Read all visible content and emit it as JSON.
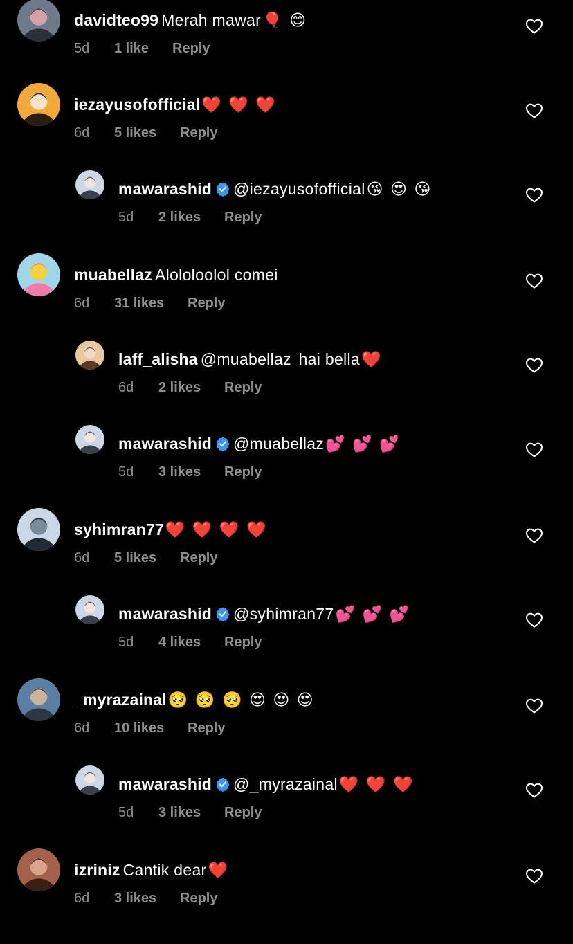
{
  "colors": {
    "background": "#000000",
    "text": "#ffffff",
    "meta": "#8e8e8e",
    "verified": "#3897f0",
    "heart_outline": "#ffffff"
  },
  "comments": [
    {
      "username": "davidteo99",
      "verified": false,
      "mention": "",
      "text": "Merah mawar",
      "emoji": "🎈 😊",
      "time": "5d",
      "likes": "1 like",
      "reply_label": "Reply",
      "like_icon": "heart-outline-icon",
      "avatar": "photo"
    },
    {
      "username": "iezayusofofficial",
      "verified": false,
      "mention": "",
      "text": "",
      "emoji": "❤️ ❤️ ❤️",
      "time": "6d",
      "likes": "5 likes",
      "reply_label": "Reply",
      "like_icon": "heart-outline-icon",
      "avatar": "photo"
    },
    {
      "username": "mawarashid",
      "verified": true,
      "mention": "@iezayusofofficial",
      "text": "",
      "emoji": "😘 😍 😘",
      "time": "5d",
      "likes": "2 likes",
      "reply_label": "Reply",
      "like_icon": "heart-outline-icon",
      "avatar": "photo"
    },
    {
      "username": "muabellaz",
      "verified": false,
      "mention": "",
      "text": "Alololoolol comei",
      "emoji": "",
      "time": "6d",
      "likes": "31 likes",
      "reply_label": "Reply",
      "like_icon": "heart-outline-icon",
      "avatar": "photo"
    },
    {
      "username": "laff_alisha",
      "verified": false,
      "mention": "@muabellaz",
      "text": " hai bella",
      "emoji": "❤️",
      "time": "6d",
      "likes": "2 likes",
      "reply_label": "Reply",
      "like_icon": "heart-outline-icon",
      "avatar": "photo"
    },
    {
      "username": "mawarashid",
      "verified": true,
      "mention": "@muabellaz",
      "text": "",
      "emoji": "💕 💕 💕",
      "time": "5d",
      "likes": "3 likes",
      "reply_label": "Reply",
      "like_icon": "heart-outline-icon",
      "avatar": "photo"
    },
    {
      "username": "syhimran77",
      "verified": false,
      "mention": "",
      "text": "",
      "emoji": "❤️ ❤️ ❤️ ❤️",
      "time": "6d",
      "likes": "5 likes",
      "reply_label": "Reply",
      "like_icon": "heart-outline-icon",
      "avatar": "photo"
    },
    {
      "username": "mawarashid",
      "verified": true,
      "mention": "@syhimran77",
      "text": "",
      "emoji": "💕 💕 💕",
      "time": "5d",
      "likes": "4 likes",
      "reply_label": "Reply",
      "like_icon": "heart-outline-icon",
      "avatar": "photo"
    },
    {
      "username": "_myrazainal",
      "verified": false,
      "mention": "",
      "text": "",
      "emoji": "🥺 🥺 🥺 😍 😍 😍",
      "time": "6d",
      "likes": "10 likes",
      "reply_label": "Reply",
      "like_icon": "heart-outline-icon",
      "avatar": "photo"
    },
    {
      "username": "mawarashid",
      "verified": true,
      "mention": "@_myrazainal",
      "text": "",
      "emoji": "❤️ ❤️ ❤️",
      "time": "5d",
      "likes": "3 likes",
      "reply_label": "Reply",
      "like_icon": "heart-outline-icon",
      "avatar": "photo"
    },
    {
      "username": "izriniz",
      "verified": false,
      "mention": "",
      "text": "Cantik dear",
      "emoji": "❤️",
      "time": "6d",
      "likes": "3 likes",
      "reply_label": "Reply",
      "like_icon": "heart-outline-icon",
      "avatar": "photo"
    }
  ]
}
